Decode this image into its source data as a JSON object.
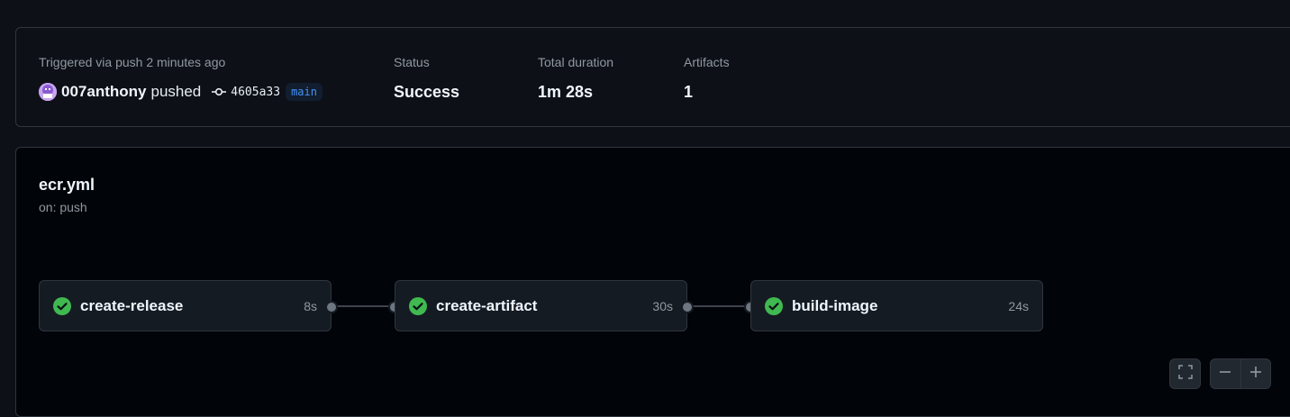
{
  "summary": {
    "trigger_label": "Triggered via push 2 minutes ago",
    "user": "007anthony",
    "action": "pushed",
    "commit_sha": "4605a33",
    "branch": "main",
    "status_label": "Status",
    "status_value": "Success",
    "duration_label": "Total duration",
    "duration_value": "1m 28s",
    "artifacts_label": "Artifacts",
    "artifacts_value": "1"
  },
  "workflow": {
    "name": "ecr.yml",
    "trigger": "on: push",
    "jobs": [
      {
        "name": "create-release",
        "duration": "8s",
        "status": "success"
      },
      {
        "name": "create-artifact",
        "duration": "30s",
        "status": "success"
      },
      {
        "name": "build-image",
        "duration": "24s",
        "status": "success"
      }
    ]
  },
  "colors": {
    "success": "#3fb950",
    "branch": "#4493f8",
    "background": "#0d1117"
  },
  "icons": {
    "avatar": "user-avatar",
    "commit": "git-commit-icon",
    "job_status": "check-circle-fill-icon",
    "fullscreen": "fullscreen-icon",
    "zoom_out": "minus-icon",
    "zoom_in": "plus-icon"
  }
}
